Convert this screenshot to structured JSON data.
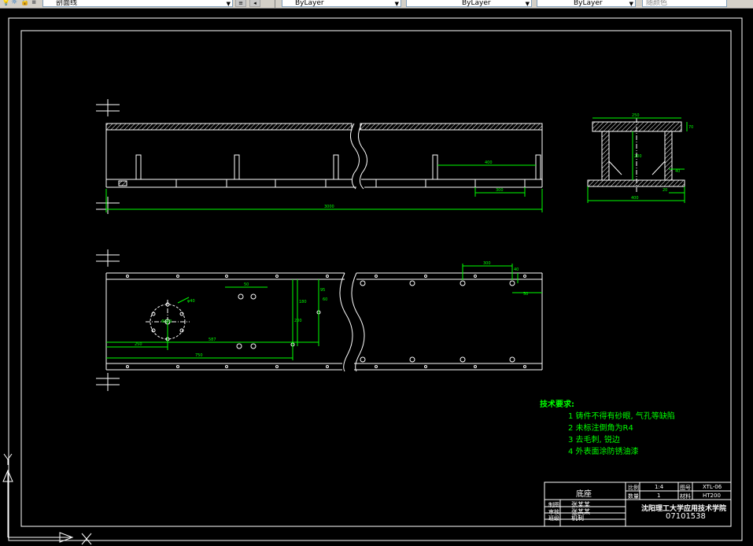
{
  "toolbar": {
    "layer_name": "剖面线",
    "color_value": "ByLayer",
    "linetype_value": "ByLayer",
    "lineweight_value": "ByLayer",
    "plotstyle_value": "随颜色"
  },
  "drawing": {
    "front_view": {
      "overall_length": "3000",
      "dim_right_400": "400",
      "dim_right_300": "300"
    },
    "side_view": {
      "dim_top": "250",
      "dim_height": "200",
      "dim_bottom": "400",
      "dim_right_a": "70",
      "dim_right_b": "40",
      "dim_right_c": "20"
    },
    "plan_view": {
      "dim_250": "250",
      "dim_587": "587",
      "dim_750": "750",
      "dim_200": "200",
      "dim_50": "50",
      "dim_180": "180",
      "dim_95": "95",
      "dim_60": "60",
      "dim_circle": "Φ200",
      "dim_r40": "φ40",
      "dim_right_300": "300",
      "dim_right_40": "40",
      "dim_right_50": "50"
    }
  },
  "notes": {
    "heading": "技术要求:",
    "items": [
      "1 铸件不得有砂眼, 气孔等缺陷",
      "2 未标注倒角为R4",
      "3 去毛刺, 锐边",
      "4 外表面涂防锈油漆"
    ]
  },
  "title_block": {
    "part_name": "底座",
    "scale_label": "比例",
    "scale_value": "1:4",
    "qty_label": "数量",
    "qty_value": "1",
    "material_label": "材料",
    "material_value": "HT200",
    "drawing_no_label": "图号",
    "drawing_no_value": "XTL-06",
    "designer_label": "制图",
    "designer_name": "张某某",
    "checker_label": "审核",
    "checker_name": "张某某",
    "class_label": "班级",
    "class_name": "机制",
    "school": "沈阳理工大学应用技术学院",
    "student_id": "07101538"
  },
  "ucs": {
    "x_label": "X",
    "y_label": "Y"
  },
  "colors": {
    "background": "#000000",
    "lines": "#ffffff",
    "dims": "#00ff00",
    "hatch": "#ffffff"
  }
}
